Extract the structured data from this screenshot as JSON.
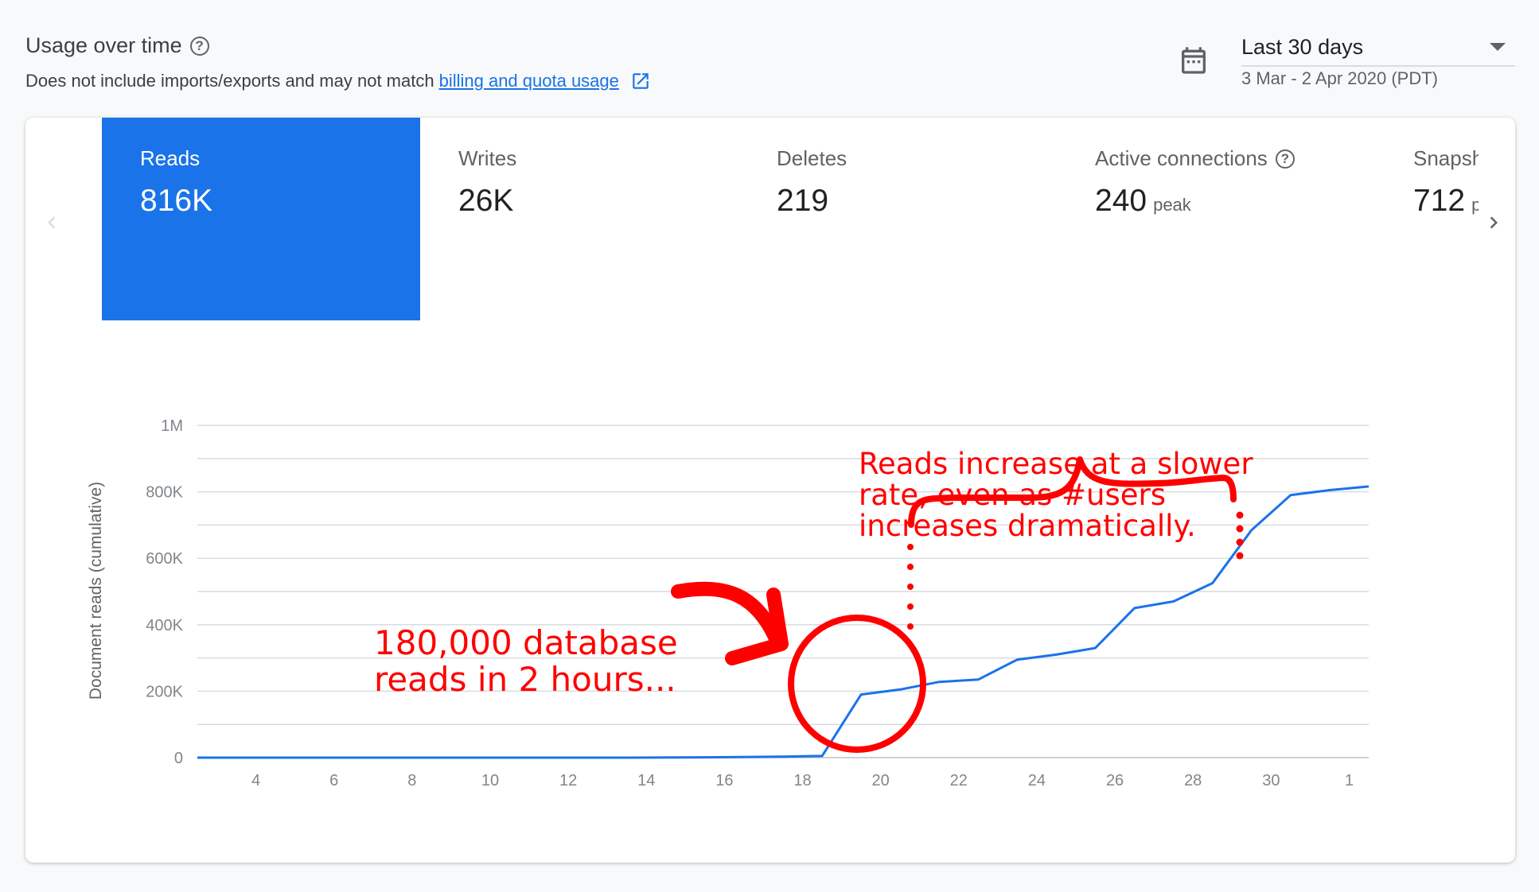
{
  "header": {
    "title": "Usage over time",
    "subtitle_prefix": "Does not include imports/exports and may not match ",
    "link_text": "billing and quota usage"
  },
  "date_range": {
    "selected": "Last 30 days",
    "range_text": "3 Mar - 2 Apr 2020 (PDT)"
  },
  "metrics": [
    {
      "label": "Reads",
      "value": "816K",
      "suffix": "",
      "active": true,
      "help": false
    },
    {
      "label": "Writes",
      "value": "26K",
      "suffix": "",
      "active": false,
      "help": false
    },
    {
      "label": "Deletes",
      "value": "219",
      "suffix": "",
      "active": false,
      "help": false
    },
    {
      "label": "Active connections",
      "value": "240",
      "suffix": "peak",
      "active": false,
      "help": true
    },
    {
      "label": "Snapshot listeners",
      "value": "712",
      "suffix": "peak",
      "active": false,
      "help": false
    }
  ],
  "icons": [
    "help-icon",
    "external-link-icon",
    "calendar-icon",
    "dropdown-caret-icon",
    "chevron-left-icon",
    "chevron-right-icon"
  ],
  "colors": {
    "accent": "#1a73e8",
    "annotation": "#ff0000",
    "grid": "#dadce0",
    "axis_text": "#80868b"
  },
  "annotations": {
    "slower_rate": "Reads increase at a slower\nrate, even as #users\nincreases dramatically.",
    "spike": "180,000 database\nreads in 2 hours..."
  },
  "chart_data": {
    "type": "line",
    "title": "",
    "xlabel": "",
    "ylabel": "Document reads (cumulative)",
    "x_tick_labels": [
      "4",
      "6",
      "8",
      "10",
      "12",
      "14",
      "16",
      "18",
      "20",
      "22",
      "24",
      "26",
      "28",
      "30",
      "1"
    ],
    "y_tick_labels": [
      "0",
      "200K",
      "400K",
      "600K",
      "800K",
      "1M"
    ],
    "ylim": [
      0,
      1000000
    ],
    "grid": true,
    "legend": "none",
    "series": [
      {
        "color": "#1a73e8",
        "x": [
          "Mar 3",
          "Mar 4",
          "Mar 6",
          "Mar 8",
          "Mar 10",
          "Mar 12",
          "Mar 14",
          "Mar 16",
          "Mar 18",
          "Mar 19",
          "Mar 20",
          "Mar 21",
          "Mar 22",
          "Mar 23",
          "Mar 24",
          "Mar 25",
          "Mar 26",
          "Mar 27",
          "Mar 28",
          "Mar 29",
          "Mar 30",
          "Mar 31",
          "Apr 1",
          "Apr 2"
        ],
        "values": [
          0,
          0,
          0,
          0,
          0,
          0,
          0,
          1000,
          3000,
          5000,
          190000,
          205000,
          228000,
          235000,
          295000,
          310000,
          330000,
          450000,
          470000,
          525000,
          685000,
          790000,
          805000,
          816000
        ]
      }
    ]
  }
}
